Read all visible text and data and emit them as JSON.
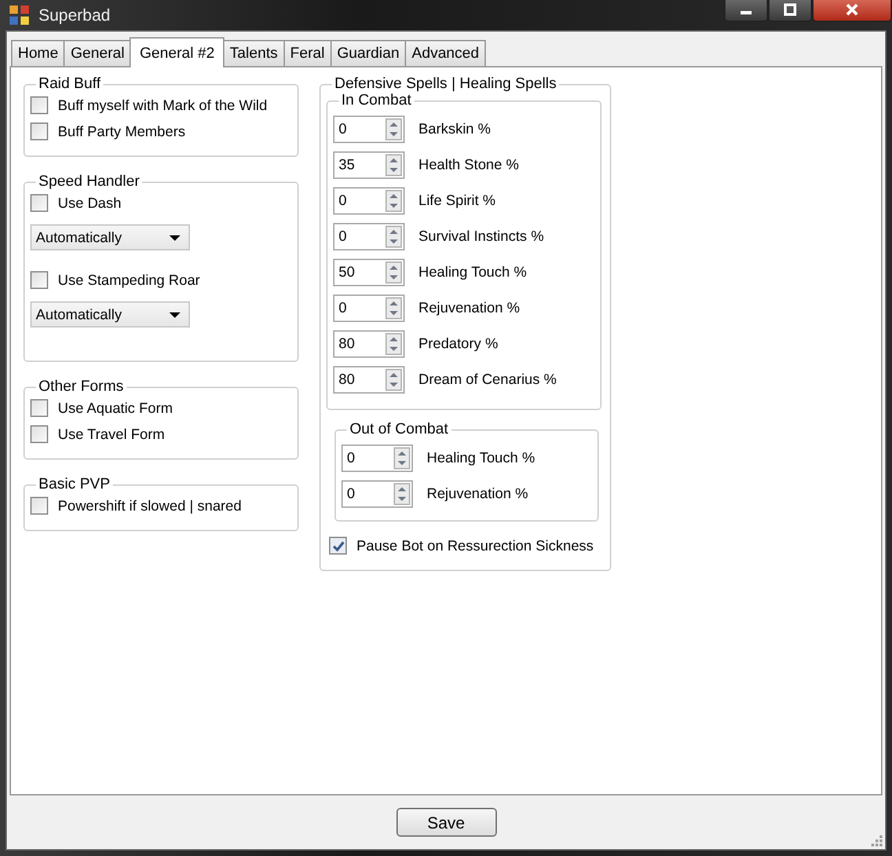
{
  "window": {
    "title": "Superbad"
  },
  "tabs": [
    {
      "label": "Home",
      "selected": false
    },
    {
      "label": "General",
      "selected": false
    },
    {
      "label": "General #2",
      "selected": true
    },
    {
      "label": "Talents",
      "selected": false
    },
    {
      "label": "Feral",
      "selected": false
    },
    {
      "label": "Guardian",
      "selected": false
    },
    {
      "label": "Advanced",
      "selected": false
    }
  ],
  "left_groups": [
    {
      "title": "Raid Buff",
      "items": [
        {
          "kind": "checkbox",
          "label": "Buff myself with Mark of the Wild",
          "checked": false
        },
        {
          "kind": "checkbox",
          "label": "Buff Party Members",
          "checked": false
        }
      ]
    },
    {
      "title": "Speed Handler",
      "items": [
        {
          "kind": "checkbox",
          "label": "Use Dash",
          "checked": false
        },
        {
          "kind": "dropdown",
          "value": "Automatically"
        },
        {
          "kind": "checkbox",
          "label": "Use Stampeding Roar",
          "checked": false
        },
        {
          "kind": "dropdown",
          "value": "Automatically"
        }
      ]
    },
    {
      "title": "Other Forms",
      "items": [
        {
          "kind": "checkbox",
          "label": "Use Aquatic Form",
          "checked": false
        },
        {
          "kind": "checkbox",
          "label": "Use Travel Form",
          "checked": false
        }
      ]
    },
    {
      "title": "Basic PVP",
      "items": [
        {
          "kind": "checkbox",
          "label": "Powershift if slowed | snared",
          "checked": false
        }
      ]
    }
  ],
  "defensive": {
    "title": "Defensive Spells | Healing Spells",
    "in_combat": {
      "title": "In Combat",
      "rows": [
        {
          "value": "0",
          "label": "Barkskin %"
        },
        {
          "value": "35",
          "label": "Health Stone %"
        },
        {
          "value": "0",
          "label": "Life Spirit %"
        },
        {
          "value": "0",
          "label": "Survival Instincts %"
        },
        {
          "value": "50",
          "label": "Healing Touch %"
        },
        {
          "value": "0",
          "label": "Rejuvenation %"
        },
        {
          "value": "80",
          "label": "Predatory %"
        },
        {
          "value": "80",
          "label": "Dream of Cenarius %"
        }
      ]
    },
    "out_of_combat": {
      "title": "Out of Combat",
      "rows": [
        {
          "value": "0",
          "label": "Healing Touch %"
        },
        {
          "value": "0",
          "label": "Rejuvenation %"
        }
      ]
    },
    "pause": {
      "label": "Pause Bot on Ressurection Sickness",
      "checked": true
    }
  },
  "save_button": "Save"
}
